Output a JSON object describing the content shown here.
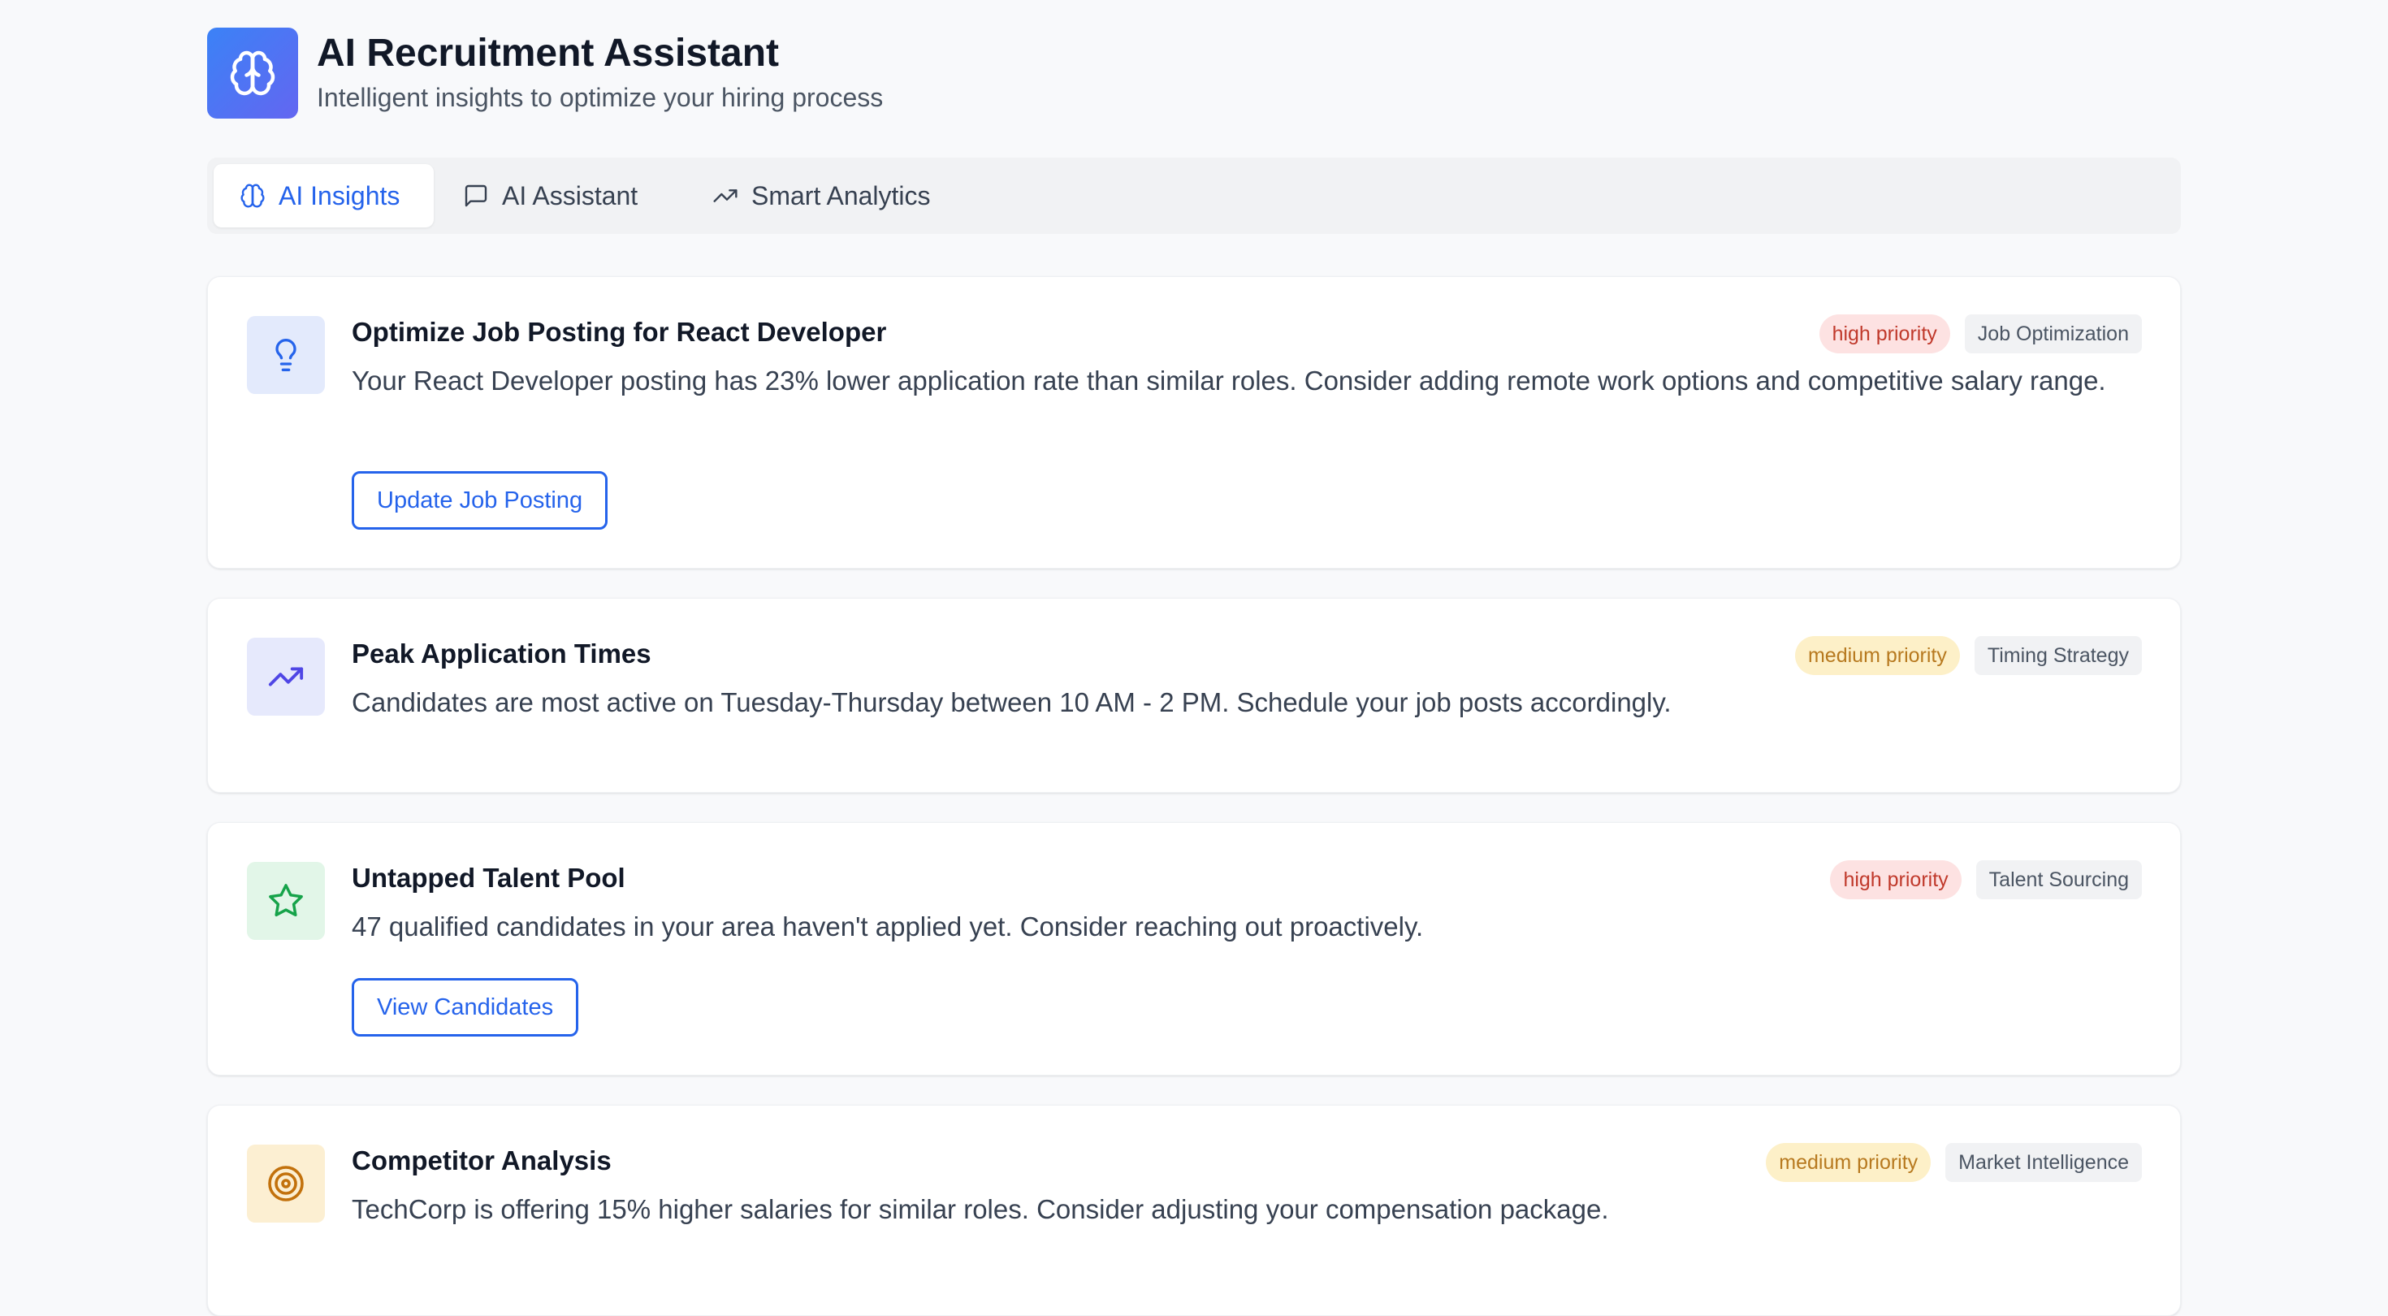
{
  "app": {
    "title": "AI Recruitment Assistant",
    "subtitle": "Intelligent insights to optimize your hiring process",
    "logo_icon": "brain-icon",
    "accent_color": "#2563eb"
  },
  "tabs": [
    {
      "label": "AI Insights",
      "icon": "brain-icon",
      "active": true
    },
    {
      "label": "AI Assistant",
      "icon": "message-square-icon",
      "active": false
    },
    {
      "label": "Smart Analytics",
      "icon": "trending-up-icon",
      "active": false
    }
  ],
  "insights": [
    {
      "title": "Optimize Job Posting for React Developer",
      "description": "Your React Developer posting has 23% lower application rate than similar roles. Consider adding remote work options and competitive salary range.",
      "priority": "high priority",
      "category": "Job Optimization",
      "icon": "lightbulb-icon",
      "action": "Update Job Posting"
    },
    {
      "title": "Peak Application Times",
      "description": "Candidates are most active on Tuesday-Thursday between 10 AM - 2 PM. Schedule your job posts accordingly.",
      "priority": "medium priority",
      "category": "Timing Strategy",
      "icon": "trending-up-icon"
    },
    {
      "title": "Untapped Talent Pool",
      "description": "47 qualified candidates in your area haven't applied yet. Consider reaching out proactively.",
      "priority": "high priority",
      "category": "Talent Sourcing",
      "icon": "star-icon",
      "action": "View Candidates"
    },
    {
      "title": "Competitor Analysis",
      "description": "TechCorp is offering 15% higher salaries for similar roles. Consider adjusting your compensation package.",
      "priority": "medium priority",
      "category": "Market Intelligence",
      "icon": "target-icon"
    }
  ],
  "colors": {
    "high_priority_bg": "#fde2e2",
    "high_priority_text": "#c0392b",
    "medium_priority_bg": "#fdf0c8",
    "medium_priority_text": "#b7791f"
  }
}
